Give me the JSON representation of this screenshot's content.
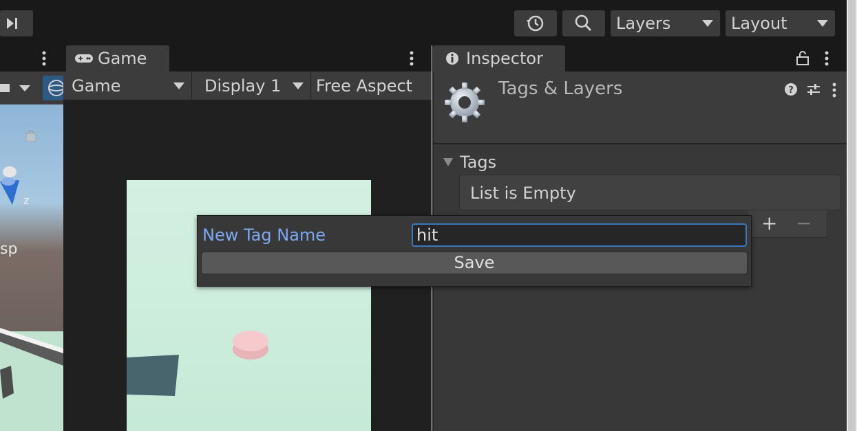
{
  "toolbar": {
    "layers_label": "Layers",
    "layout_label": "Layout"
  },
  "scene": {
    "axis_label": "z",
    "persp_label": "sp"
  },
  "game": {
    "tab_label": "Game",
    "game_dropdown": "Game",
    "display_dropdown": "Display 1",
    "aspect_dropdown": "Free Aspect"
  },
  "inspector": {
    "tab_label": "Inspector",
    "title": "Tags & Layers",
    "tags_section": "Tags",
    "list_empty": "List is Empty",
    "add_symbol": "+",
    "remove_symbol": "−"
  },
  "popup": {
    "label": "New Tag Name",
    "input_value": "hit",
    "save_label": "Save"
  },
  "colors": {
    "accent": "#3a79bb",
    "label_blue": "#7ba9f0",
    "panel_bg": "#383838",
    "toolbar_bg": "#191919"
  }
}
